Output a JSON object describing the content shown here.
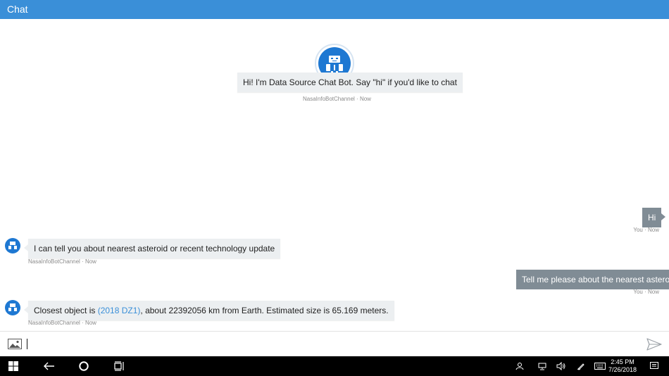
{
  "app": {
    "title": "Chat"
  },
  "welcome": {
    "text": "Hi! I'm Data Source Chat Bot. Say \"hi\" if you'd like to chat",
    "meta": "NasaInfoBotChannel · Now"
  },
  "messages": [
    {
      "from": "user",
      "text": "Hi",
      "meta": "You · Now"
    },
    {
      "from": "bot",
      "text": "I can tell you about nearest asteroid or recent technology update",
      "meta": "NasaInfoBotChannel · Now"
    },
    {
      "from": "user",
      "text": "Tell me please about the nearest asteroid",
      "meta": "You · Now"
    },
    {
      "from": "bot",
      "text_before": "Closest object is ",
      "link": "(2018 DZ1)",
      "text_after": ", about 22392056 km from Earth. Estimated size is 65.169 meters.",
      "meta": "NasaInfoBotChannel · Now"
    }
  ],
  "input": {
    "value": "",
    "upload_icon": "image-upload-icon",
    "send_icon": "send-icon"
  },
  "taskbar": {
    "time": "2:45 PM",
    "date": "7/26/2018",
    "icons": [
      "windows-start-icon",
      "back-arrow-icon",
      "cortana-circle-icon",
      "task-view-icon",
      "people-icon",
      "network-icon",
      "volume-icon",
      "pen-icon",
      "keyboard-icon",
      "notification-icon"
    ]
  },
  "colors": {
    "accent": "#3a8fd8",
    "bot_avatar": "#1e78d2",
    "user_bubble": "#808c95",
    "bot_bubble": "#eceff1"
  }
}
